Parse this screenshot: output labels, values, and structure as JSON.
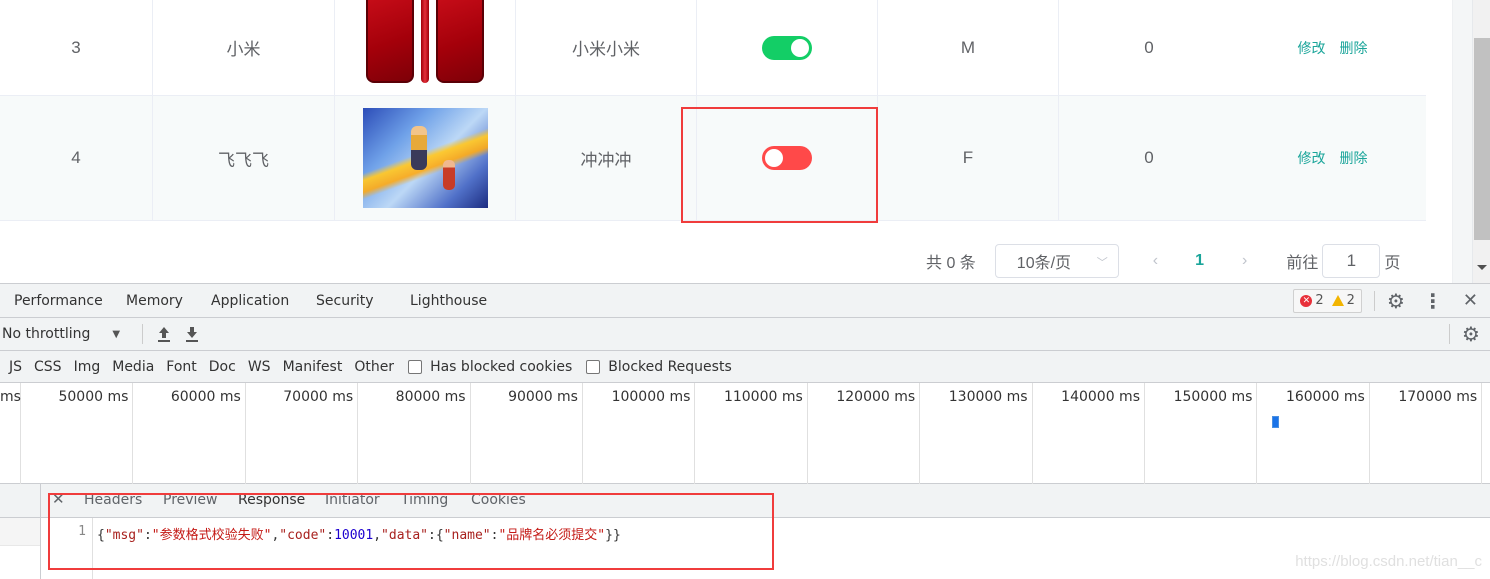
{
  "table": {
    "rows": [
      {
        "id": "3",
        "name": "小米",
        "image": "red-phone-thumbnail",
        "desc": "小米小米",
        "status_on": true,
        "status_color": "#13ce66",
        "sex": "M",
        "sort": "0",
        "edit": "修改",
        "delete": "删除"
      },
      {
        "id": "4",
        "name": "飞飞飞",
        "image": "game-art-thumbnail",
        "desc": "冲冲冲",
        "status_on": false,
        "status_color": "#ff4949",
        "sex": "F",
        "sort": "0",
        "edit": "修改",
        "delete": "删除"
      }
    ]
  },
  "pagination": {
    "total": "共 0 条",
    "page_size": "10条/页",
    "prev": "‹",
    "current": "1",
    "next": "›",
    "goto_label": "前往",
    "goto_value": "1",
    "page_label": "页"
  },
  "devtools": {
    "tabs": [
      "Performance",
      "Memory",
      "Application",
      "Security",
      "Lighthouse"
    ],
    "errors": "2",
    "warnings": "2",
    "throttling": "No throttling",
    "filters": [
      "JS",
      "CSS",
      "Img",
      "Media",
      "Font",
      "Doc",
      "WS",
      "Manifest",
      "Other"
    ],
    "checkboxes": [
      "Has blocked cookies",
      "Blocked Requests"
    ],
    "timeline_ticks": [
      "ms",
      "50000 ms",
      "60000 ms",
      "70000 ms",
      "80000 ms",
      "90000 ms",
      "100000 ms",
      "110000 ms",
      "120000 ms",
      "130000 ms",
      "140000 ms",
      "150000 ms",
      "160000 ms",
      "170000 ms"
    ],
    "detail_tabs": [
      "Headers",
      "Preview",
      "Response",
      "Initiator",
      "Timing",
      "Cookies"
    ],
    "active_detail_tab": "Response",
    "response": {
      "line_number": "1",
      "msg_key": "\"msg\"",
      "msg_value": "\"参数格式校验失败\"",
      "code_key": "\"code\"",
      "code_value": "10001",
      "data_key": "\"data\"",
      "name_key": "\"name\"",
      "name_value": "\"品牌名必须提交\""
    }
  },
  "watermark": "https://blog.csdn.net/tian__c",
  "accent_color": "#1aa59a",
  "highlight_color": "#f03c3c"
}
